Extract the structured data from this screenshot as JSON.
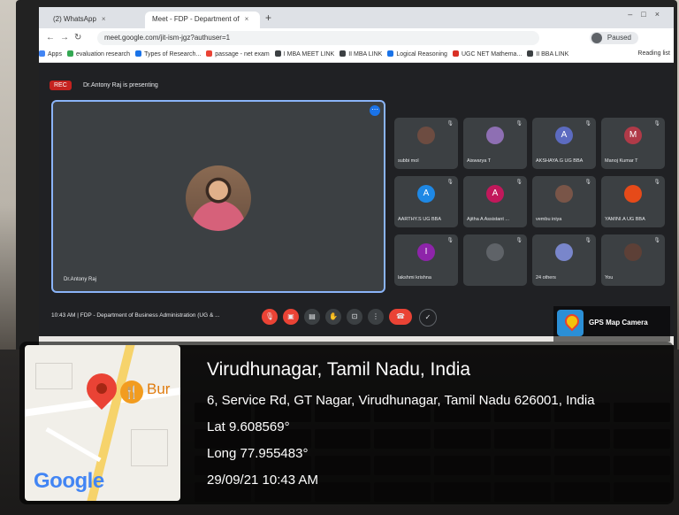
{
  "browser": {
    "tabs": [
      {
        "label": "(2) WhatsApp",
        "close": "×"
      },
      {
        "label": "Meet - FDP - Department of",
        "close": "×"
      }
    ],
    "new_tab": "+",
    "url": "meet.google.com/jit-ism-jgz?authuser=1",
    "profile_label": "Paused",
    "bookmarks": [
      {
        "label": "Apps",
        "color": "#4285f4"
      },
      {
        "label": "evaluation research",
        "color": "#34a853"
      },
      {
        "label": "Types of Research...",
        "color": "#1a73e8"
      },
      {
        "label": "passage - net exam",
        "color": "#ea4335"
      },
      {
        "label": "I MBA MEET LINK",
        "color": "#3c4043"
      },
      {
        "label": "II MBA LINK",
        "color": "#3c4043"
      },
      {
        "label": "Logical Reasoning",
        "color": "#1a73e8"
      },
      {
        "label": "UGC NET Mathema...",
        "color": "#d93025"
      },
      {
        "label": "II BBA LINK",
        "color": "#3c4043"
      }
    ],
    "reading_list": "Reading list"
  },
  "meet": {
    "rec_label": "REC",
    "presenting_text": "Dr.Antony Raj is presenting",
    "main_tile_name": "Dr.Antony Raj",
    "participants": [
      {
        "name": "subbi mol",
        "initial": "",
        "color": "#6d4c41"
      },
      {
        "name": "Aiswarya T",
        "initial": "",
        "color": "#8e6fb3"
      },
      {
        "name": "AKSHAYA.G UG BBA",
        "initial": "A",
        "color": "#5c6bc0"
      },
      {
        "name": "Manoj Kumar T",
        "initial": "M",
        "color": "#b03a48"
      },
      {
        "name": "AARTHY.S UG BBA",
        "initial": "A",
        "color": "#1e88e5"
      },
      {
        "name": "Ajitha A Assistant ...",
        "initial": "A",
        "color": "#c2185b"
      },
      {
        "name": "vembu iniya",
        "initial": "",
        "color": "#795548"
      },
      {
        "name": "YAMINI.A UG BBA",
        "initial": "",
        "color": "#e64a19"
      },
      {
        "name": "lakshmi krishna",
        "initial": "I",
        "color": "#8e24aa"
      },
      {
        "name": "",
        "initial": "",
        "color": "#5f6368"
      },
      {
        "name": "24 others",
        "initial": "",
        "color": "#7986cb"
      },
      {
        "name": "You",
        "initial": "",
        "color": "#5d4037"
      }
    ],
    "meeting_info": "10:43 AM  |  FDP - Department of Business Administration (UG & ..."
  },
  "gps": {
    "badge_label": "GPS Map Camera",
    "map_poi_label": "Bur",
    "google_label": "Google",
    "location_title": "Virudhunagar, Tamil Nadu, India",
    "address": "6, Service Rd, GT Nagar, Virudhunagar, Tamil Nadu 626001, India",
    "lat": "Lat 9.608569°",
    "long": "Long 77.955483°",
    "datetime": "29/09/21 10:43 AM"
  },
  "colors": {
    "meet_bg": "#202124",
    "tile_bg": "#3c4043",
    "accent_blue": "#8ab4f8",
    "end_call_red": "#ea4335"
  }
}
